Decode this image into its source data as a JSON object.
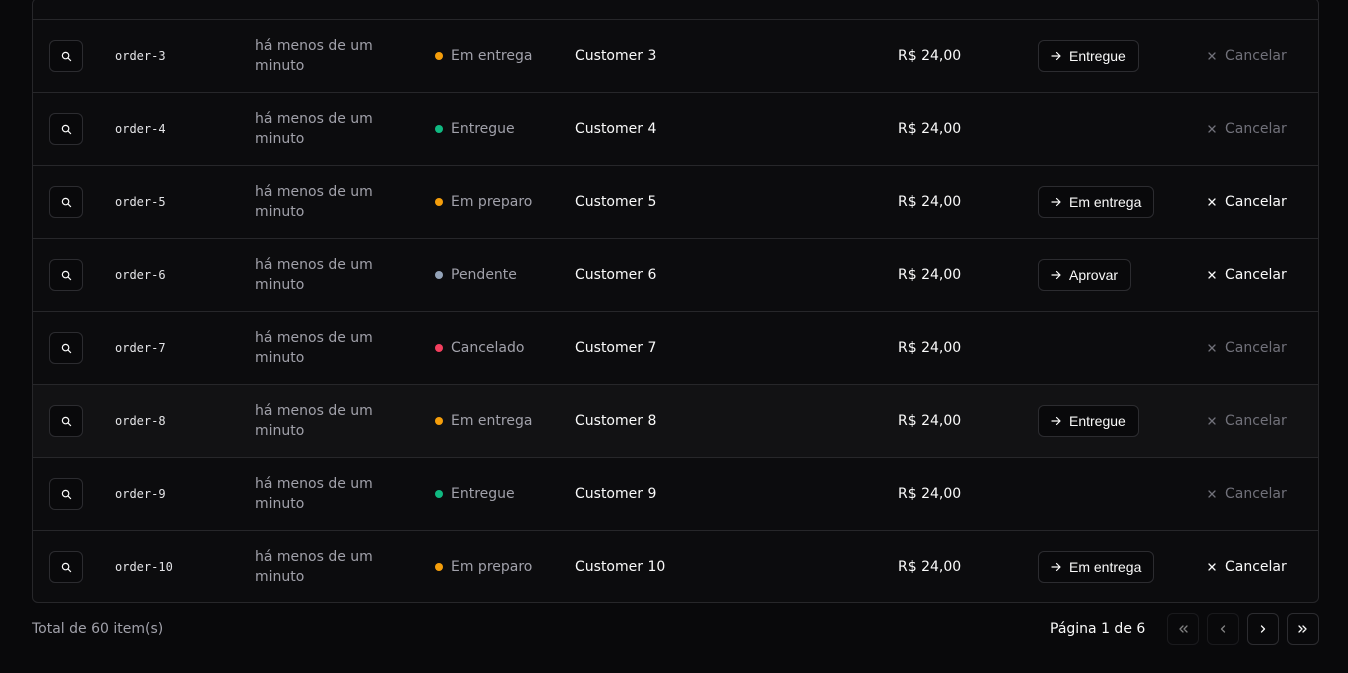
{
  "rows": [
    {
      "id": "order-3",
      "time": "há menos de um minuto",
      "status": "Em entrega",
      "status_color": "#f59e0b",
      "customer": "Customer 3",
      "price": "R$ 24,00",
      "action": "Entregue",
      "cancel": "Cancelar",
      "cancel_enabled": false
    },
    {
      "id": "order-4",
      "time": "há menos de um minuto",
      "status": "Entregue",
      "status_color": "#10b981",
      "customer": "Customer 4",
      "price": "R$ 24,00",
      "action": null,
      "cancel": "Cancelar",
      "cancel_enabled": false
    },
    {
      "id": "order-5",
      "time": "há menos de um minuto",
      "status": "Em preparo",
      "status_color": "#f59e0b",
      "customer": "Customer 5",
      "price": "R$ 24,00",
      "action": "Em entrega",
      "cancel": "Cancelar",
      "cancel_enabled": true
    },
    {
      "id": "order-6",
      "time": "há menos de um minuto",
      "status": "Pendente",
      "status_color": "#94a3b8",
      "customer": "Customer 6",
      "price": "R$ 24,00",
      "action": "Aprovar",
      "cancel": "Cancelar",
      "cancel_enabled": true
    },
    {
      "id": "order-7",
      "time": "há menos de um minuto",
      "status": "Cancelado",
      "status_color": "#f43f5e",
      "customer": "Customer 7",
      "price": "R$ 24,00",
      "action": null,
      "cancel": "Cancelar",
      "cancel_enabled": false
    },
    {
      "id": "order-8",
      "time": "há menos de um minuto",
      "status": "Em entrega",
      "status_color": "#f59e0b",
      "customer": "Customer 8",
      "price": "R$ 24,00",
      "action": "Entregue",
      "cancel": "Cancelar",
      "cancel_enabled": false
    },
    {
      "id": "order-9",
      "time": "há menos de um minuto",
      "status": "Entregue",
      "status_color": "#10b981",
      "customer": "Customer 9",
      "price": "R$ 24,00",
      "action": null,
      "cancel": "Cancelar",
      "cancel_enabled": false
    },
    {
      "id": "order-10",
      "time": "há menos de um minuto",
      "status": "Em preparo",
      "status_color": "#f59e0b",
      "customer": "Customer 10",
      "price": "R$ 24,00",
      "action": "Em entrega",
      "cancel": "Cancelar",
      "cancel_enabled": true
    }
  ],
  "footer": {
    "total": "Total de 60 item(s)",
    "page": "Página 1 de 6"
  },
  "icons": {
    "details": "search-icon",
    "action": "arrow-right-icon",
    "cancel": "x-icon",
    "first": "chevrons-left-icon",
    "prev": "chevron-left-icon",
    "next": "chevron-right-icon",
    "last": "chevrons-right-icon"
  }
}
